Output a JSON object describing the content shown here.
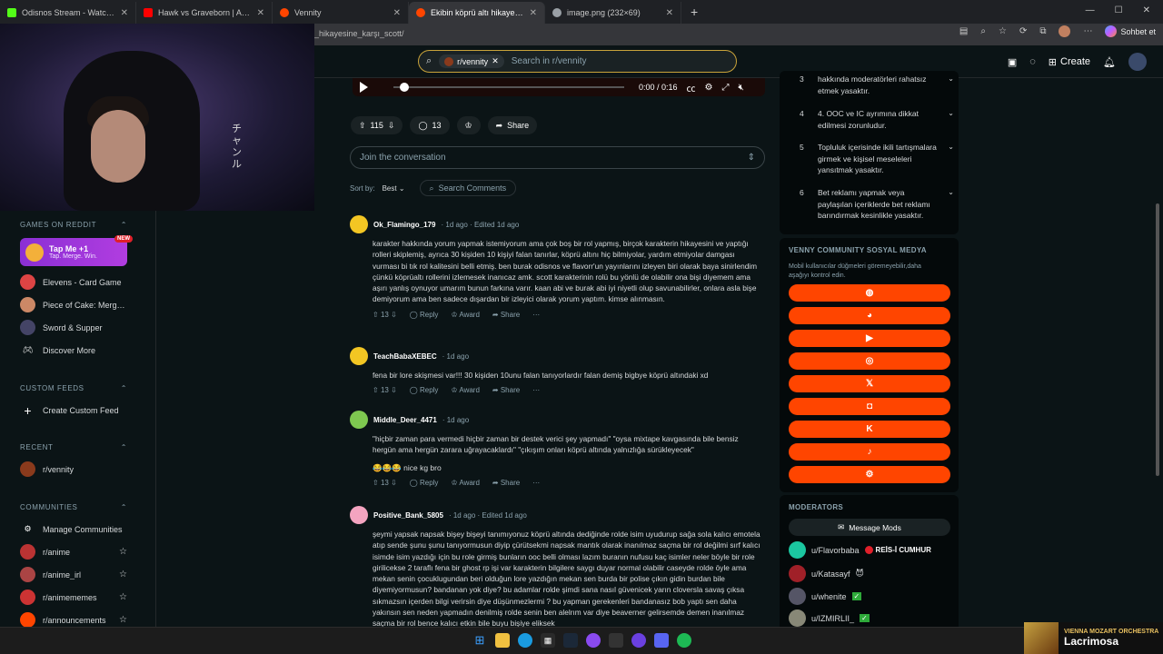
{
  "browser": {
    "tabs": [
      {
        "label": "Odisnos Stream - Watch Live on Ki",
        "color": "#53fc18"
      },
      {
        "label": "Hawk vs Graveborn | Adam Kaçırma",
        "color": "#ff0000"
      },
      {
        "label": "Vennity",
        "color": "#ff4500"
      },
      {
        "label": "Ekibin köprü altı hikayesine karşı S",
        "color": "#ff4500"
      },
      {
        "label": "image.png (232×69)",
        "color": "#9aa0a6"
      }
    ],
    "new_tab": "+",
    "url": "_hikayesine_karşı_scott/",
    "sohbet": "Sohbet et"
  },
  "header": {
    "community_chip": "r/vennity",
    "search_placeholder": "Search in r/vennity",
    "create": "Create"
  },
  "webcam": {
    "overlay_text": "チ\nャ\nン\nル"
  },
  "sidebar": {
    "games_title": "GAMES ON REDDIT",
    "tapme_title": "Tap Me +1",
    "tapme_sub": "Tap. Merge. Win.",
    "new_badge": "NEW",
    "games": [
      "Elevens - Card Game",
      "Piece of Cake: Merge...",
      "Sword & Supper",
      "Discover More"
    ],
    "custom_title": "CUSTOM FEEDS",
    "create_feed": "Create Custom Feed",
    "recent_title": "RECENT",
    "recent": [
      "r/vennity"
    ],
    "communities_title": "COMMUNITIES",
    "manage": "Manage Communities",
    "communities": [
      "r/anime",
      "r/anime_irl",
      "r/animememes",
      "r/announcements"
    ]
  },
  "video": {
    "time": "0:00 / 0:16"
  },
  "post_actions": {
    "votes": "115",
    "comments": "13",
    "share": "Share"
  },
  "join_placeholder": "Join the conversation",
  "sort": {
    "label": "Sort by:",
    "value": "Best",
    "search": "Search Comments"
  },
  "comments": [
    {
      "user": "Ok_Flamingo_179",
      "meta": "· 1d ago · Edited 1d ago",
      "color": "#f3c623",
      "body": "karakter hakkında yorum yapmak istemiyorum ama çok boş bir rol yapmış, birçok karakterin hikayesini ve yaptığı rolleri skiplemiş, ayrıca 30 kişiden 10 kişiyi falan tanırlar, köprü altını hiç bilmiyolar, yardım etmiyolar damgası vurması bi tık rol kalitesini belli etmiş. ben burak odisnos ve flavorr'un yayınlarını izleyen biri olarak baya sinirlendim çünkü köprüaltı rollerini izlemesek inanıcaz amk. scott karakterinin rolü bu yönlü de olabilir ona bişi diyemem ama aşırı yanlış oynuyor umarım bunun farkına varır. kaan abi ve burak abi iyi niyetli olup savunabilirler, onlara asla bişe demiyorum ama ben sadece dışardan bir izleyici olarak yorum yaptım. kimse alınmasın.",
      "votes": "13",
      "reply": "Reply",
      "award": "Award",
      "share": "Share",
      "more": "···"
    },
    {
      "user": "TeachBabaXEBEC",
      "meta": "· 1d ago",
      "color": "#f3c623",
      "body": "fena bir lore skişmesi var!!! 30 kişiden 10unu falan tanıyorlardır falan demiş bigbye köprü altındaki xd",
      "votes": "13",
      "reply": "Reply",
      "award": "Award",
      "share": "Share",
      "more": "···"
    },
    {
      "user": "Middle_Deer_4471",
      "meta": "· 1d ago",
      "color": "#7ec850",
      "body": "\"hiçbir zaman para vermedi hiçbir zaman bir destek verici şey yapmadı\" \"oysa mixtape kavgasında bile bensiz hergün ama hergün zarara uğrayacaklardı\" \"çıkışım onları köprü altında yalnızlığa sürükleyecek\"",
      "emoji": "😂😂😂",
      "emoji_text": "nice kg bro",
      "votes": "13",
      "reply": "Reply",
      "award": "Award",
      "share": "Share",
      "more": "···"
    },
    {
      "user": "Positive_Bank_5805",
      "meta": "· 1d ago · Edited 1d ago",
      "color": "#f4a4c0",
      "body": "şeymi yapsak napsak bişey bişeyi tanımıyonuz köprü altında dediğinde rolde isim uyudurup sağa sola kalıcı emotela atıp sende şunu şunu tanıyormusun diyip çürütsekmi napsak mantık olarak inanılmaz saçma bir rol değilmi sırf kalıcı isimde isim yazdığı için bu role girmiş bunların ooc belli olması lazım buranın nufusu kaç isimler neler böyle bir role girilicekse 2 taraflı fena bir ghost rp işi var karakterin bilgilere saygı duyar normal olabilir caseyde rolde öyle ama mekan senin çocuklugundan beri olduğun lore yazdığın mekan sen burda bir polise çıkın gidin burdan bile diyemiyormusun? bandanan yok diye? bu adamlar rolde şimdi sana nasıl güvenicek yarın cloversla savaş çıksa sıkmazsın içerden bilgi verirsin diye düşünmezlermi ? bu yapman gerekenleri bandanasız bob yaptı sen daha yakınsın sen neden yapmadın denilmiş rolde senin ben alelrım var diye beaverner gelirsemde demen inanılmaz saçma bir rol bence kalıcı etkin bile buyu bişiye eliksek"
    }
  ],
  "rules": [
    {
      "n": "3",
      "text": "hakkında moderatörleri rahatsız etmek yasaktır."
    },
    {
      "n": "4",
      "text": "4. OOC ve IC ayrımına dikkat edilmesi zorunludur."
    },
    {
      "n": "5",
      "text": "Topluluk içerisinde ikili tartışmalara girmek ve kişisel meseleleri yansıtmak yasaktır."
    },
    {
      "n": "6",
      "text": "Bet reklamı yapmak veya paylaşılan içeriklerde bet reklamı barındırmak kesinlikle yasaktır."
    }
  ],
  "social": {
    "title": "VENNY COMMUNITY SOSYAL MEDYA",
    "subtitle": "Mobil kullanıcılar düğmeleri göremeyebilir,daha aşağıyı kontrol edin.",
    "buttons": [
      "web-icon",
      "discord-icon",
      "youtube-icon",
      "instagram-icon",
      "x-icon",
      "twitch-icon",
      "kick-icon",
      "tiktok-icon",
      "steam-icon"
    ],
    "accent": "#ff4500"
  },
  "moderators": {
    "title": "MODERATORS",
    "message": "Message Mods",
    "list": [
      {
        "name": "u/Flavorbaba",
        "flair": "REİS-İ CUMHUR",
        "color": "#1bc7a0"
      },
      {
        "name": "u/Katasayf",
        "flair": "",
        "color": "#a02028"
      },
      {
        "name": "u/whenite",
        "flair": "",
        "color": "#556"
      },
      {
        "name": "u/IZMIRLII_",
        "flair": "",
        "color": "#887"
      }
    ]
  },
  "music": {
    "artist": "VIENNA MOZART ORCHESTRA",
    "title": "Lacrimosa"
  }
}
